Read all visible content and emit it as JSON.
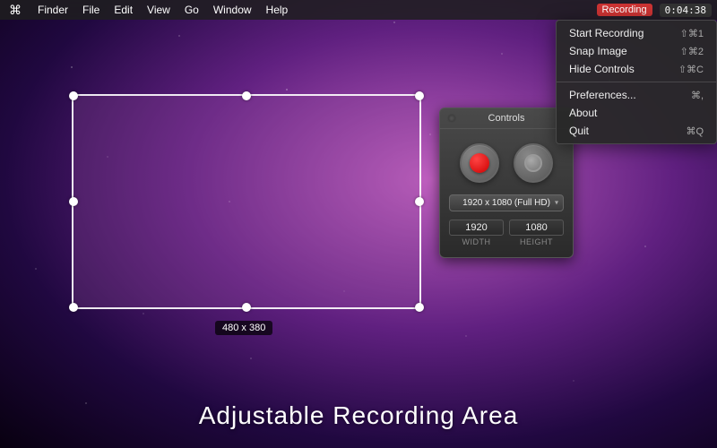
{
  "menubar": {
    "apple": "⌘",
    "items": [
      {
        "label": "Finder"
      },
      {
        "label": "File"
      },
      {
        "label": "Edit"
      },
      {
        "label": "View"
      },
      {
        "label": "Go"
      },
      {
        "label": "Window"
      },
      {
        "label": "Help"
      }
    ],
    "recording_label": "Recording",
    "time": "0:04:38"
  },
  "dropdown": {
    "items": [
      {
        "label": "Start Recording",
        "shortcut": "⇧⌘1"
      },
      {
        "label": "Snap Image",
        "shortcut": "⇧⌘2"
      },
      {
        "label": "Hide Controls",
        "shortcut": "⇧⌘C"
      },
      {
        "separator": true
      },
      {
        "label": "Preferences...",
        "shortcut": "⌘,"
      },
      {
        "label": "About",
        "shortcut": ""
      },
      {
        "label": "Quit",
        "shortcut": "⌘Q"
      }
    ]
  },
  "recording_area": {
    "dimensions_label": "480 x 380"
  },
  "controls": {
    "title": "Controls",
    "resolution": "1920 x 1080 (Full HD)",
    "width_value": "1920",
    "height_value": "1080",
    "width_label": "WIDTH",
    "height_label": "HEIGHT"
  },
  "bottom_title": "Adjustable Recording Area"
}
